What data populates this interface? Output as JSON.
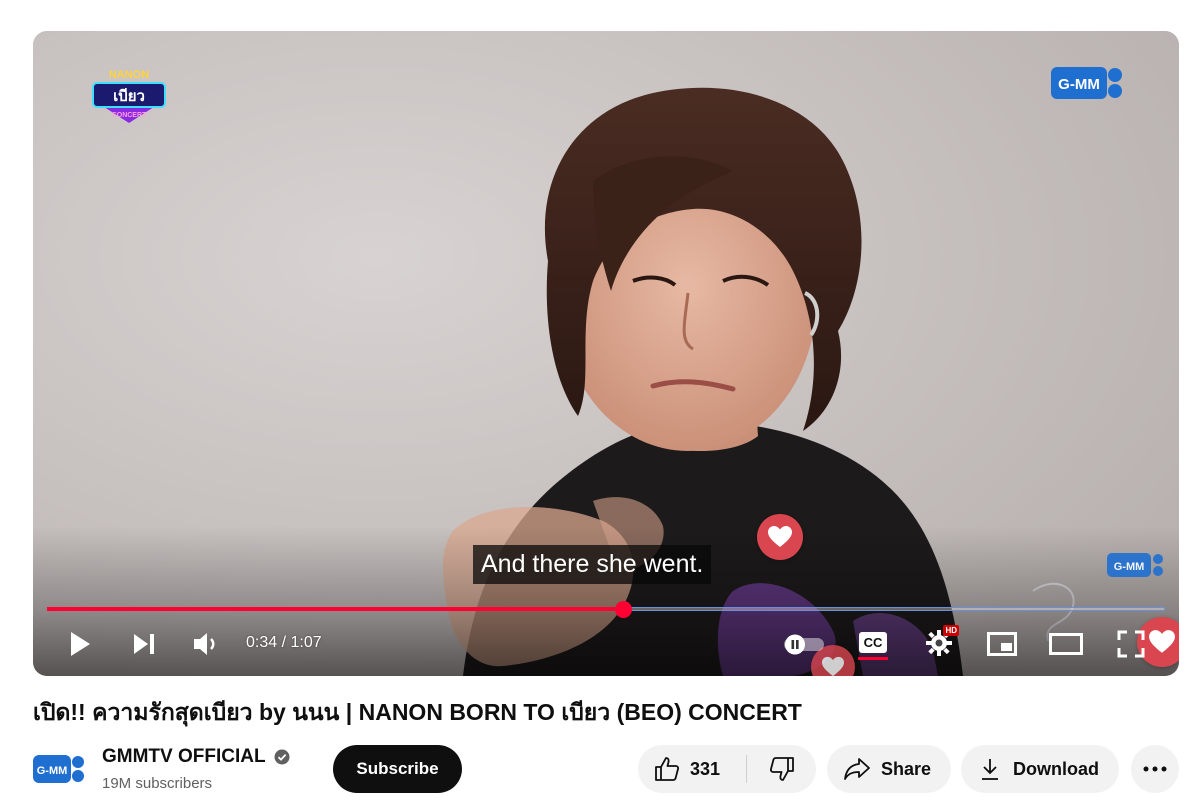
{
  "video": {
    "subtitle": "And there she went.",
    "current_time": "0:34",
    "duration": "1:07",
    "time_display": "0:34 / 1:07",
    "progress_fraction": 0.515,
    "quality_badge": "HD",
    "overlay_logo_text": "G-MM",
    "show_logo_lines": [
      "NANON",
      "เบียว",
      "CONCERT"
    ],
    "controls": {
      "play_icon": "play-icon",
      "next_icon": "next-icon",
      "volume_icon": "volume-icon",
      "autoplay_icon": "autoplay-toggle-icon",
      "captions_label": "CC",
      "settings_icon": "gear-icon",
      "miniplayer_icon": "miniplayer-icon",
      "theater_icon": "theater-icon",
      "fullscreen_icon": "fullscreen-icon"
    }
  },
  "title": "เปิด!! ความรักสุดเบียว by นนน | NANON BORN TO เบียว (BEO) CONCERT",
  "channel": {
    "name": "GMMTV OFFICIAL",
    "subscribers": "19M subscribers",
    "avatar_text": "G-MM",
    "verified_icon": "verified-check-icon"
  },
  "actions": {
    "subscribe_label": "Subscribe",
    "like_count": "331",
    "share_label": "Share",
    "download_label": "Download"
  },
  "colors": {
    "accent_red": "#ff0033",
    "gmm_blue": "#1f6fd1",
    "heart_red": "#d9464f"
  }
}
